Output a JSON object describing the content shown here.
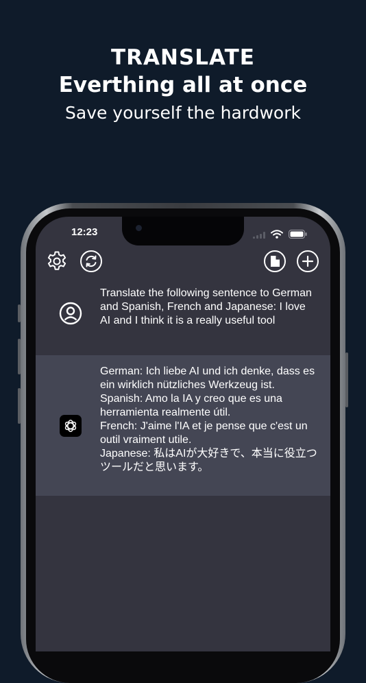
{
  "headline": {
    "line1": "TRANSLATE",
    "line2": "Everthing all at once",
    "line3": "Save yourself the hardwork"
  },
  "status_bar": {
    "time": "12:23"
  },
  "toolbar": {
    "left_icons": [
      "gear-icon",
      "refresh-icon"
    ],
    "right_icons": [
      "history-icon",
      "add-icon"
    ]
  },
  "conversation": {
    "user_message": "Translate the following sentence to German and Spanish, French and Japanese: I love AI and I think it is a really useful tool",
    "assistant_message": "German: Ich liebe AI und ich denke, dass es ein wirklich nützliches Werkzeug ist.\nSpanish: Amo la IA y creo que es una herramienta realmente útil.\nFrench: J'aime l'IA et je pense que c'est un outil vraiment utile.\nJapanese: 私はAIが大好きで、本当に役立つツールだと思います。"
  },
  "colors": {
    "background": "#0f1b2a",
    "screen": "#34343f",
    "assistant_row": "#444654",
    "text": "#ffffff"
  }
}
